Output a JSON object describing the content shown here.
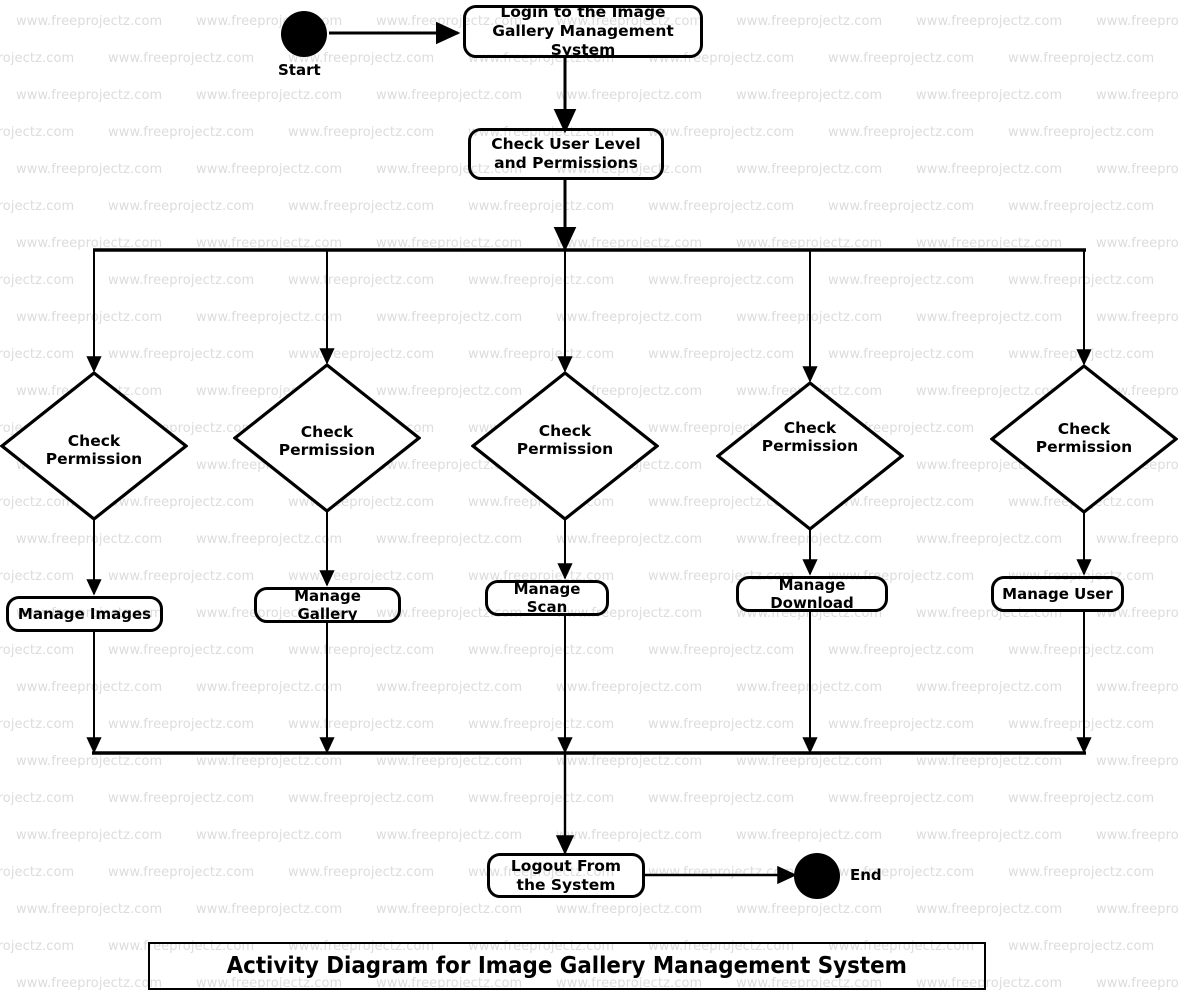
{
  "diagram": {
    "title": "Activity Diagram for Image Gallery Management System",
    "type": "uml-activity-diagram",
    "colors": {
      "stroke": "#000000",
      "fill": "#ffffff",
      "watermark": "#dcdcdc"
    },
    "watermark_text": "www.freeprojectz.com",
    "start": {
      "label": "Start"
    },
    "end": {
      "label": "End"
    },
    "activities": {
      "login": "Login to the Image Gallery Management System",
      "check_user": "Check User Level and Permissions",
      "logout": "Logout From the System"
    },
    "decisions": [
      {
        "id": "d1",
        "label_line1": "Check",
        "label_line2": "Permission"
      },
      {
        "id": "d2",
        "label_line1": "Check",
        "label_line2": "Permission"
      },
      {
        "id": "d3",
        "label_line1": "Check",
        "label_line2": "Permission"
      },
      {
        "id": "d4",
        "label_line1": "Check",
        "label_line2": "Permission"
      },
      {
        "id": "d5",
        "label_line1": "Check",
        "label_line2": "Permission"
      }
    ],
    "actions": [
      {
        "id": "a1",
        "label": "Manage Images"
      },
      {
        "id": "a2",
        "label": "Manage Gallery"
      },
      {
        "id": "a3",
        "label": "Manage Scan"
      },
      {
        "id": "a4",
        "label": "Manage Download"
      },
      {
        "id": "a5",
        "label": "Manage User"
      }
    ]
  }
}
